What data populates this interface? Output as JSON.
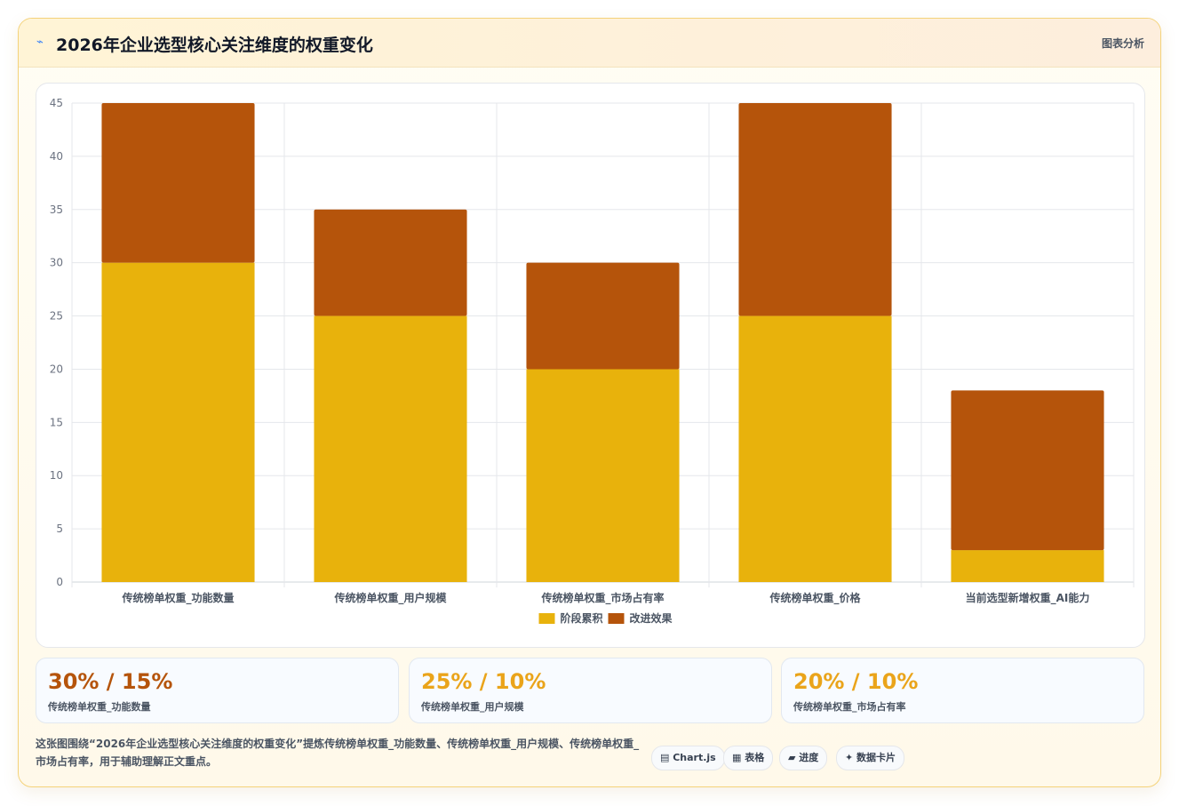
{
  "header": {
    "icon": "chart-line-icon",
    "title": "2026年企业选型核心关注维度的权重变化",
    "tag": "图表分析"
  },
  "chart_data": {
    "type": "bar",
    "stacked": true,
    "categories": [
      "传统榜单权重_功能数量",
      "传统榜单权重_用户规模",
      "传统榜单权重_市场占有率",
      "传统榜单权重_价格",
      "当前选型新增权重_AI能力"
    ],
    "series": [
      {
        "name": "阶段累积",
        "values": [
          30,
          25,
          20,
          25,
          3
        ],
        "color": "#e8b20c"
      },
      {
        "name": "改进效果",
        "values": [
          15,
          10,
          10,
          20,
          15
        ],
        "color": "#b5540b"
      }
    ],
    "ylim": [
      0,
      45
    ],
    "yticks": [
      0,
      5,
      10,
      15,
      20,
      25,
      30,
      35,
      40,
      45
    ],
    "grid": true,
    "legend": "bottom"
  },
  "stats": [
    {
      "value": "30% / 15%",
      "label": "传统榜单权重_功能数量",
      "color": "#b5540b"
    },
    {
      "value": "25% / 10%",
      "label": "传统榜单权重_用户规模",
      "color": "#eaa41a"
    },
    {
      "value": "20% / 10%",
      "label": "传统榜单权重_市场占有率",
      "color": "#eaa41a"
    }
  ],
  "footer": {
    "description": "这张图围绕“2026年企业选型核心关注维度的权重变化”提炼传统榜单权重_功能数量、传统榜单权重_用户规模、传统榜单权重_市场占有率，用于辅助理解正文重点。",
    "pills": [
      "▤ Chart.js",
      "▦ 表格",
      "▰ 进度",
      "✦ 数据卡片"
    ]
  }
}
